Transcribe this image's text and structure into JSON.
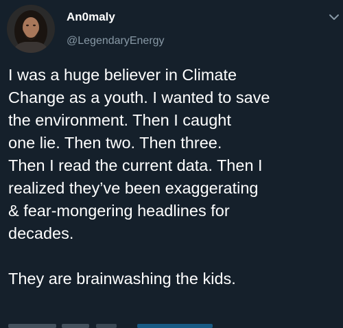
{
  "author": {
    "display_name": "An0maly",
    "handle": "@LegendaryEnergy",
    "avatar_icon": "profile-avatar-icon"
  },
  "tweet": {
    "lines": [
      "I was a huge believer in Climate",
      "Change as a youth. I wanted to save",
      "the environment. Then I caught",
      "one lie. Then two. Then three.",
      "Then I read the current data. Then I",
      "realized they’ve been exaggerating",
      "& fear-mongering headlines for",
      "decades."
    ],
    "closing_line": "They are brainwashing the kids."
  },
  "icons": {
    "menu": "chevron-down-icon"
  },
  "colors": {
    "background": "#15202b",
    "text": "#ffffff",
    "secondary_text": "#8899a6"
  }
}
